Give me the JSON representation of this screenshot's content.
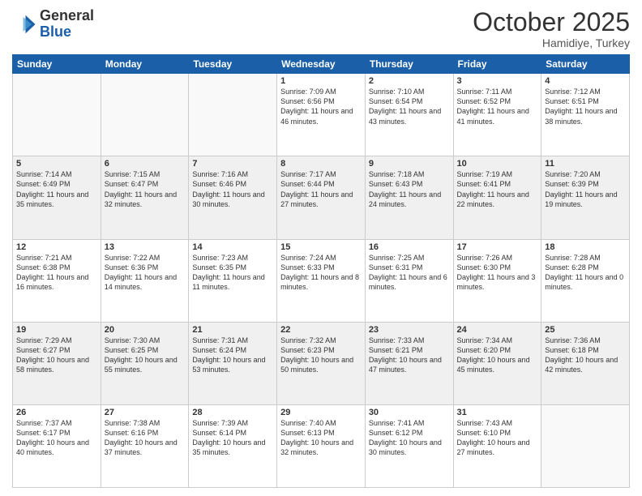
{
  "header": {
    "logo_line1": "General",
    "logo_line2": "Blue",
    "month": "October 2025",
    "location": "Hamidiye, Turkey"
  },
  "days_of_week": [
    "Sunday",
    "Monday",
    "Tuesday",
    "Wednesday",
    "Thursday",
    "Friday",
    "Saturday"
  ],
  "weeks": [
    [
      {
        "day": "",
        "text": ""
      },
      {
        "day": "",
        "text": ""
      },
      {
        "day": "",
        "text": ""
      },
      {
        "day": "1",
        "text": "Sunrise: 7:09 AM\nSunset: 6:56 PM\nDaylight: 11 hours and 46 minutes."
      },
      {
        "day": "2",
        "text": "Sunrise: 7:10 AM\nSunset: 6:54 PM\nDaylight: 11 hours and 43 minutes."
      },
      {
        "day": "3",
        "text": "Sunrise: 7:11 AM\nSunset: 6:52 PM\nDaylight: 11 hours and 41 minutes."
      },
      {
        "day": "4",
        "text": "Sunrise: 7:12 AM\nSunset: 6:51 PM\nDaylight: 11 hours and 38 minutes."
      }
    ],
    [
      {
        "day": "5",
        "text": "Sunrise: 7:14 AM\nSunset: 6:49 PM\nDaylight: 11 hours and 35 minutes."
      },
      {
        "day": "6",
        "text": "Sunrise: 7:15 AM\nSunset: 6:47 PM\nDaylight: 11 hours and 32 minutes."
      },
      {
        "day": "7",
        "text": "Sunrise: 7:16 AM\nSunset: 6:46 PM\nDaylight: 11 hours and 30 minutes."
      },
      {
        "day": "8",
        "text": "Sunrise: 7:17 AM\nSunset: 6:44 PM\nDaylight: 11 hours and 27 minutes."
      },
      {
        "day": "9",
        "text": "Sunrise: 7:18 AM\nSunset: 6:43 PM\nDaylight: 11 hours and 24 minutes."
      },
      {
        "day": "10",
        "text": "Sunrise: 7:19 AM\nSunset: 6:41 PM\nDaylight: 11 hours and 22 minutes."
      },
      {
        "day": "11",
        "text": "Sunrise: 7:20 AM\nSunset: 6:39 PM\nDaylight: 11 hours and 19 minutes."
      }
    ],
    [
      {
        "day": "12",
        "text": "Sunrise: 7:21 AM\nSunset: 6:38 PM\nDaylight: 11 hours and 16 minutes."
      },
      {
        "day": "13",
        "text": "Sunrise: 7:22 AM\nSunset: 6:36 PM\nDaylight: 11 hours and 14 minutes."
      },
      {
        "day": "14",
        "text": "Sunrise: 7:23 AM\nSunset: 6:35 PM\nDaylight: 11 hours and 11 minutes."
      },
      {
        "day": "15",
        "text": "Sunrise: 7:24 AM\nSunset: 6:33 PM\nDaylight: 11 hours and 8 minutes."
      },
      {
        "day": "16",
        "text": "Sunrise: 7:25 AM\nSunset: 6:31 PM\nDaylight: 11 hours and 6 minutes."
      },
      {
        "day": "17",
        "text": "Sunrise: 7:26 AM\nSunset: 6:30 PM\nDaylight: 11 hours and 3 minutes."
      },
      {
        "day": "18",
        "text": "Sunrise: 7:28 AM\nSunset: 6:28 PM\nDaylight: 11 hours and 0 minutes."
      }
    ],
    [
      {
        "day": "19",
        "text": "Sunrise: 7:29 AM\nSunset: 6:27 PM\nDaylight: 10 hours and 58 minutes."
      },
      {
        "day": "20",
        "text": "Sunrise: 7:30 AM\nSunset: 6:25 PM\nDaylight: 10 hours and 55 minutes."
      },
      {
        "day": "21",
        "text": "Sunrise: 7:31 AM\nSunset: 6:24 PM\nDaylight: 10 hours and 53 minutes."
      },
      {
        "day": "22",
        "text": "Sunrise: 7:32 AM\nSunset: 6:23 PM\nDaylight: 10 hours and 50 minutes."
      },
      {
        "day": "23",
        "text": "Sunrise: 7:33 AM\nSunset: 6:21 PM\nDaylight: 10 hours and 47 minutes."
      },
      {
        "day": "24",
        "text": "Sunrise: 7:34 AM\nSunset: 6:20 PM\nDaylight: 10 hours and 45 minutes."
      },
      {
        "day": "25",
        "text": "Sunrise: 7:36 AM\nSunset: 6:18 PM\nDaylight: 10 hours and 42 minutes."
      }
    ],
    [
      {
        "day": "26",
        "text": "Sunrise: 7:37 AM\nSunset: 6:17 PM\nDaylight: 10 hours and 40 minutes."
      },
      {
        "day": "27",
        "text": "Sunrise: 7:38 AM\nSunset: 6:16 PM\nDaylight: 10 hours and 37 minutes."
      },
      {
        "day": "28",
        "text": "Sunrise: 7:39 AM\nSunset: 6:14 PM\nDaylight: 10 hours and 35 minutes."
      },
      {
        "day": "29",
        "text": "Sunrise: 7:40 AM\nSunset: 6:13 PM\nDaylight: 10 hours and 32 minutes."
      },
      {
        "day": "30",
        "text": "Sunrise: 7:41 AM\nSunset: 6:12 PM\nDaylight: 10 hours and 30 minutes."
      },
      {
        "day": "31",
        "text": "Sunrise: 7:43 AM\nSunset: 6:10 PM\nDaylight: 10 hours and 27 minutes."
      },
      {
        "day": "",
        "text": ""
      }
    ]
  ]
}
